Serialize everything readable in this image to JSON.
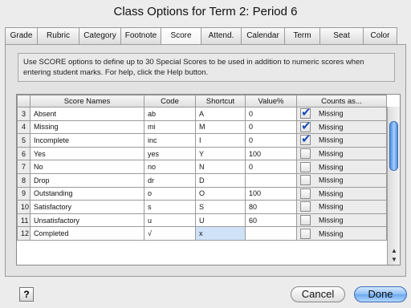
{
  "window": {
    "title": "Class Options for Term 2: Period 6"
  },
  "tabs": [
    {
      "label": "Grade",
      "active": false
    },
    {
      "label": "Rubric",
      "active": false
    },
    {
      "label": "Category",
      "active": false
    },
    {
      "label": "Footnote",
      "active": false
    },
    {
      "label": "Score",
      "active": true
    },
    {
      "label": "Attend.",
      "active": false
    },
    {
      "label": "Calendar",
      "active": false
    },
    {
      "label": "Term",
      "active": false
    },
    {
      "label": "Seat",
      "active": false
    },
    {
      "label": "Color",
      "active": false
    }
  ],
  "info_text": "Use SCORE options to define up to 30 Special Scores to be used in addition to numeric scores when entering student marks. For help, click the Help button.",
  "table": {
    "headers": {
      "num": "",
      "name": "Score Names",
      "code": "Code",
      "shortcut": "Shortcut",
      "value": "Value%",
      "counts": "Counts as..."
    },
    "rows": [
      {
        "num": "3",
        "name": "Absent",
        "code": "ab",
        "shortcut": "A",
        "value": "0",
        "checked": true,
        "counts": "Missing"
      },
      {
        "num": "4",
        "name": "Missing",
        "code": "mi",
        "shortcut": "M",
        "value": "0",
        "checked": true,
        "counts": "Missing"
      },
      {
        "num": "5",
        "name": "Incomplete",
        "code": "inc",
        "shortcut": "I",
        "value": "0",
        "checked": true,
        "counts": "Missing"
      },
      {
        "num": "6",
        "name": "Yes",
        "code": "yes",
        "shortcut": "Y",
        "value": "100",
        "checked": false,
        "counts": "Missing"
      },
      {
        "num": "7",
        "name": "No",
        "code": "no",
        "shortcut": "N",
        "value": "0",
        "checked": false,
        "counts": "Missing"
      },
      {
        "num": "8",
        "name": "Drop",
        "code": "dr",
        "shortcut": "D",
        "value": "",
        "checked": false,
        "counts": "Missing"
      },
      {
        "num": "9",
        "name": "Outstanding",
        "code": "o",
        "shortcut": "O",
        "value": "100",
        "checked": false,
        "counts": "Missing"
      },
      {
        "num": "10",
        "name": "Satisfactory",
        "code": "s",
        "shortcut": "S",
        "value": "80",
        "checked": false,
        "counts": "Missing"
      },
      {
        "num": "11",
        "name": "Unsatisfactory",
        "code": "u",
        "shortcut": "U",
        "value": "60",
        "checked": false,
        "counts": "Missing"
      },
      {
        "num": "12",
        "name": "Completed",
        "code": "√",
        "shortcut": "x",
        "value": "",
        "checked": false,
        "counts": "Missing",
        "selected_cell": "shortcut"
      }
    ]
  },
  "scrollbar": {
    "up_icon": "▲",
    "down_icon": "▼"
  },
  "buttons": {
    "help": "?",
    "cancel": "Cancel",
    "done": "Done"
  },
  "colors": {
    "accent": "#6aa8ef",
    "check": "#1a4fb8",
    "selection": "#cfe2f8"
  }
}
